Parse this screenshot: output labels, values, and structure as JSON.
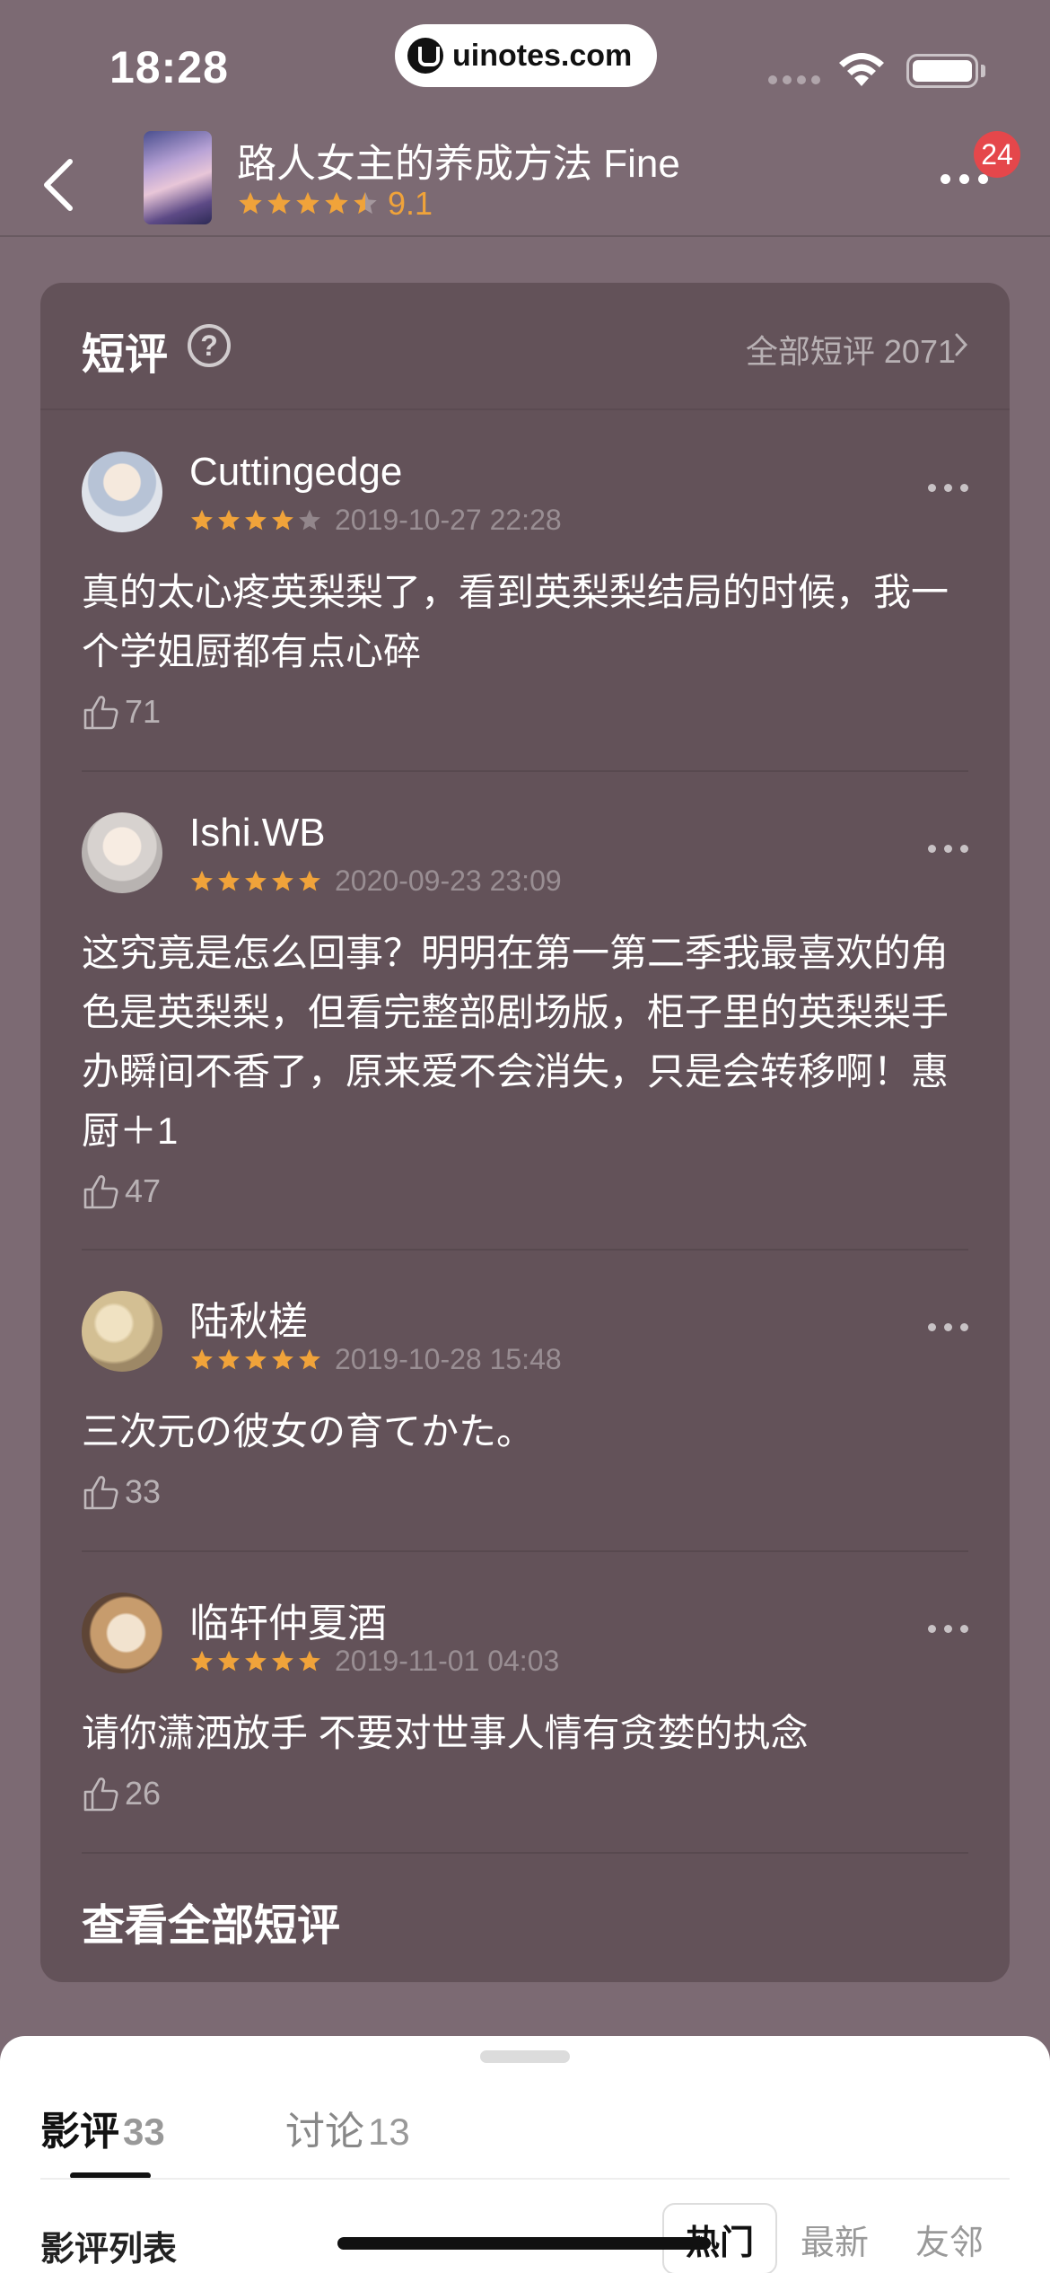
{
  "status_bar": {
    "time": "18:28",
    "watermark": "uinotes.com"
  },
  "nav": {
    "title": "路人女主的养成方法 Fine",
    "stars": 4.5,
    "score": "9.1",
    "badge": "24"
  },
  "short_reviews": {
    "title": "短评",
    "help_symbol": "?",
    "all_link": "全部短评 2071",
    "view_all": "查看全部短评",
    "items": [
      {
        "name": "Cuttingedge",
        "stars": 4,
        "date": "2019-10-27 22:28",
        "text": "真的太心疼英梨梨了，看到英梨梨结局的时候，我一个学姐厨都有点心碎",
        "likes": "71"
      },
      {
        "name": "Ishi.WB",
        "stars": 5,
        "date": "2020-09-23 23:09",
        "text": "这究竟是怎么回事？明明在第一第二季我最喜欢的角色是英梨梨，但看完整部剧场版，柜子里的英梨梨手办瞬间不香了，原来爱不会消失，只是会转移啊！惠厨＋1",
        "likes": "47"
      },
      {
        "name": "陆秋槎",
        "stars": 5,
        "date": "2019-10-28 15:48",
        "text": "三次元の彼女の育てかた。",
        "likes": "33"
      },
      {
        "name": "临轩仲夏酒",
        "stars": 5,
        "date": "2019-11-01 04:03",
        "text": "请你潇洒放手 不要对世事人情有贪婪的执念",
        "likes": "26"
      }
    ]
  },
  "sheet": {
    "tabs": [
      {
        "label": "影评",
        "count": "33"
      },
      {
        "label": "讨论",
        "count": "13"
      }
    ],
    "list_label": "影评列表",
    "sort_options": [
      "热门",
      "最新",
      "友邻"
    ],
    "sort_selected": "热门"
  },
  "colors": {
    "star": "#f0a33a",
    "badge": "#e5474b",
    "card": "#635259",
    "background": "#7c6a73"
  }
}
